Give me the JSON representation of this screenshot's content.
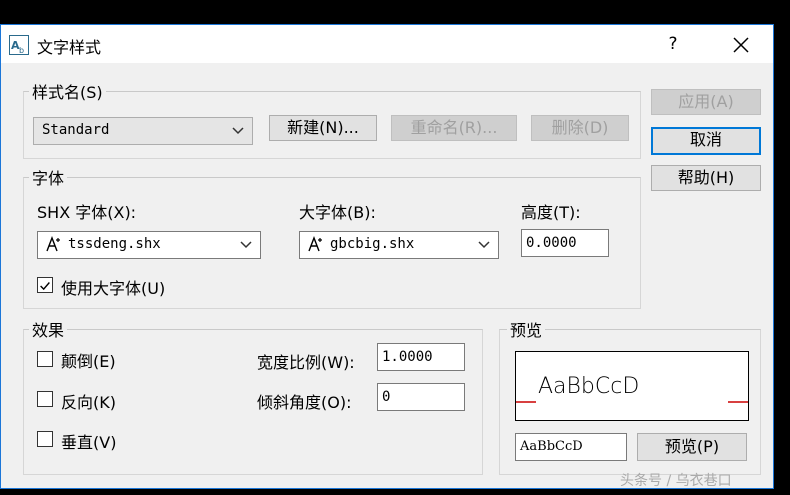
{
  "window": {
    "title": "文字样式",
    "help": "?",
    "close": "×"
  },
  "style_name": {
    "legend": "样式名(S)",
    "selected": "Standard",
    "new_button": "新建(N)...",
    "rename_button": "重命名(R)...",
    "delete_button": "删除(D)"
  },
  "font": {
    "legend": "字体",
    "shx_label": "SHX 字体(X):",
    "shx_value": "tssdeng.shx",
    "bigfont_label": "大字体(B):",
    "bigfont_value": "gbcbig.shx",
    "height_label": "高度(T):",
    "height_value": "0.0000",
    "use_bigfont_label": "使用大字体(U)",
    "use_bigfont_checked": true
  },
  "effects": {
    "legend": "效果",
    "upside_down_label": "颠倒(E)",
    "backwards_label": "反向(K)",
    "vertical_label": "垂直(V)",
    "width_factor_label": "宽度比例(W):",
    "width_factor_value": "1.0000",
    "oblique_label": "倾斜角度(O):",
    "oblique_value": "0"
  },
  "preview": {
    "legend": "预览",
    "sample_text": "AaBbCcD",
    "input_value": "AaBbCcD",
    "preview_button": "预览(P)"
  },
  "side_buttons": {
    "apply": "应用(A)",
    "cancel": "取消",
    "help": "帮助(H)"
  },
  "watermark": "头条号 / 乌衣巷口"
}
